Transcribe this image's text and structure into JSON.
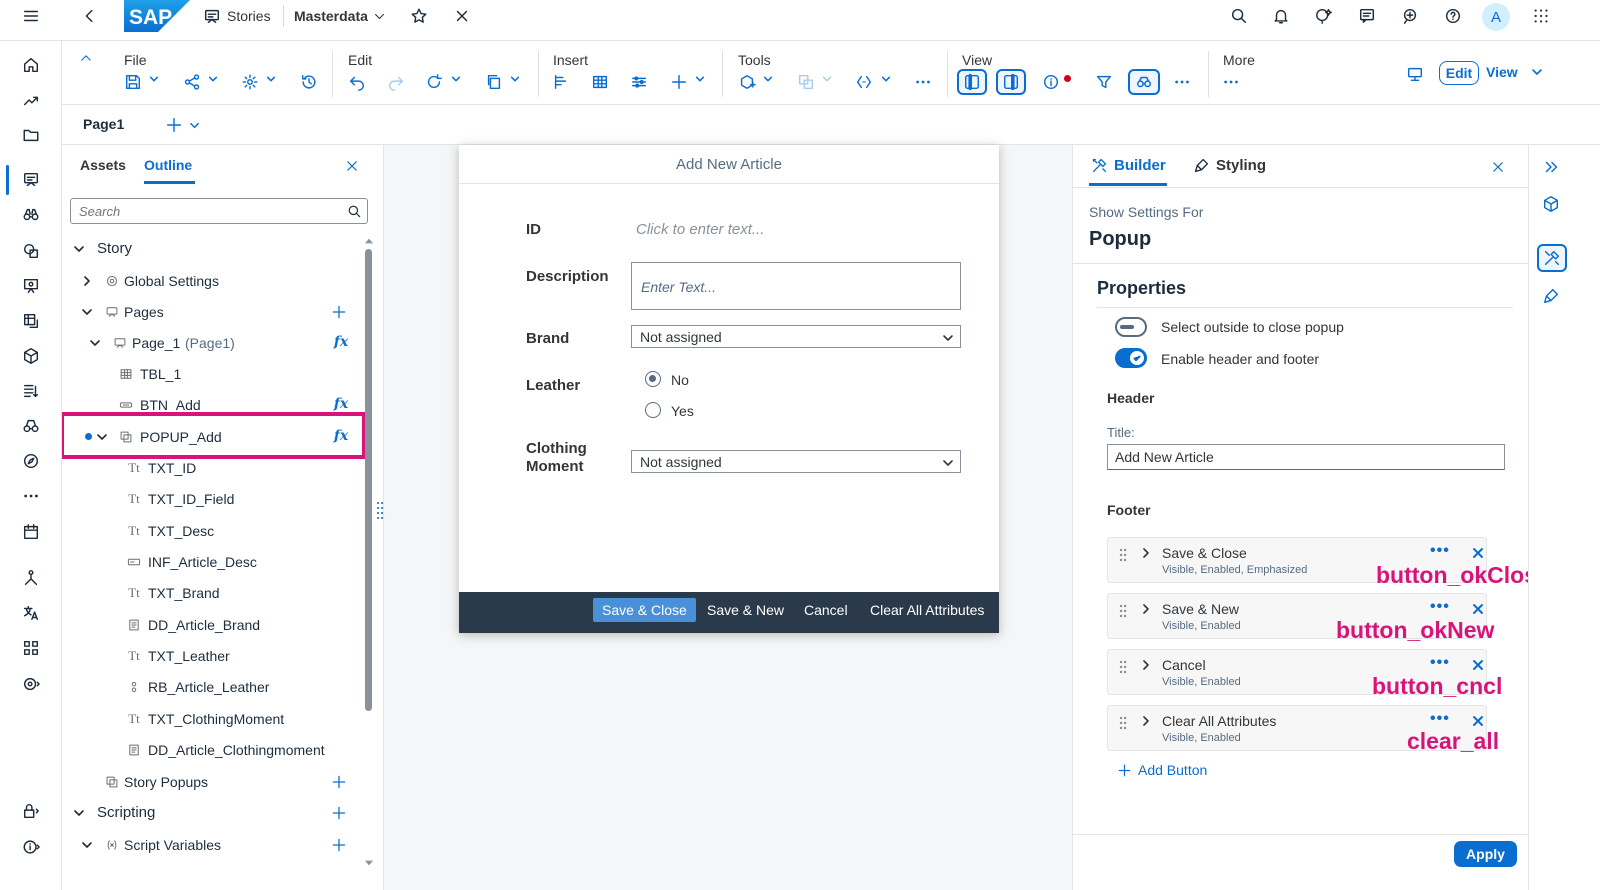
{
  "shell": {
    "stories_label": "Stories",
    "masterdata_label": "Masterdata",
    "avatar_initial": "A"
  },
  "toolbar": {
    "groups": {
      "file": "File",
      "edit": "Edit",
      "insert": "Insert",
      "tools": "Tools",
      "view": "View",
      "more": "More"
    },
    "edit_button": "Edit",
    "view_button": "View"
  },
  "pagebar": {
    "page_tab": "Page1"
  },
  "outline": {
    "tabs": [
      "Assets",
      "Outline"
    ],
    "search_placeholder": "Search",
    "tree": {
      "story": "Story",
      "global_settings": "Global Settings",
      "pages": "Pages",
      "page1": "Page_1",
      "page1_alias": "(Page1)",
      "tbl": "TBL_1",
      "btn_add": "BTN_Add",
      "popup_add": "POPUP_Add",
      "txt_id": "TXT_ID",
      "txt_id_field": "TXT_ID_Field",
      "txt_desc": "TXT_Desc",
      "inf_article_desc": "INF_Article_Desc",
      "txt_brand": "TXT_Brand",
      "dd_article_brand": "DD_Article_Brand",
      "txt_leather": "TXT_Leather",
      "rb_article_leather": "RB_Article_Leather",
      "txt_clothing_moment": "TXT_ClothingMoment",
      "dd_article_clothingmoment": "DD_Article_Clothingmoment",
      "story_popups": "Story Popups",
      "scripting": "Scripting",
      "script_variables": "Script Variables"
    }
  },
  "popup": {
    "title": "Add New Article",
    "fields": {
      "id_label": "ID",
      "id_placeholder": "Click to enter text...",
      "description_label": "Description",
      "description_placeholder": "Enter Text...",
      "brand_label": "Brand",
      "brand_value": "Not assigned",
      "leather_label": "Leather",
      "leather_options": [
        "No",
        "Yes"
      ],
      "leather_selected": "No",
      "clothing_label_1": "Clothing",
      "clothing_label_2": "Moment",
      "clothing_value": "Not assigned"
    },
    "footer_buttons": [
      "Save & Close",
      "Save & New",
      "Cancel",
      "Clear All Attributes"
    ]
  },
  "builder": {
    "tabs": [
      "Builder",
      "Styling"
    ],
    "show_settings_for": "Show Settings For",
    "component": "Popup",
    "properties_heading": "Properties",
    "toggles": [
      {
        "label": "Select outside to close popup",
        "on": false
      },
      {
        "label": "Enable header and footer",
        "on": true
      }
    ],
    "header_heading": "Header",
    "title_label": "Title:",
    "title_value": "Add New Article",
    "footer_heading": "Footer",
    "footer_items": [
      {
        "title": "Save & Close",
        "status": "Visible, Enabled, Emphasized",
        "annotation": "button_okClose"
      },
      {
        "title": "Save & New",
        "status": "Visible, Enabled",
        "annotation": "button_okNew"
      },
      {
        "title": "Cancel",
        "status": "Visible, Enabled",
        "annotation": "button_cncl"
      },
      {
        "title": "Clear All Attributes",
        "status": "Visible, Enabled",
        "annotation": "clear_all"
      }
    ],
    "add_button": "Add Button",
    "apply_button": "Apply"
  },
  "colors": {
    "accent": "#0a6ed1",
    "annotation": "#d8147a",
    "footer_bg": "#2b3a4a"
  }
}
